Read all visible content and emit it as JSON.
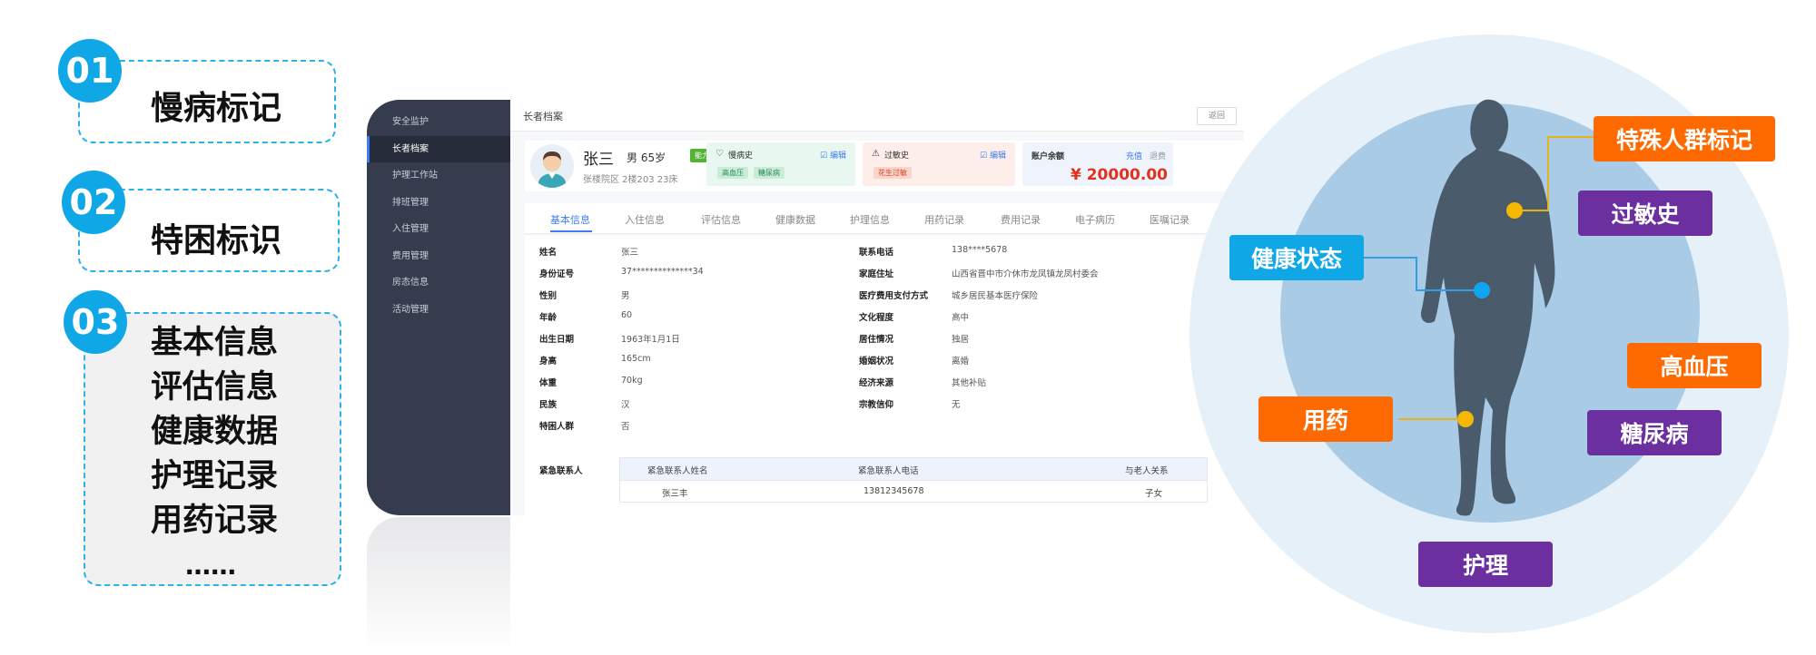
{
  "features": [
    {
      "num": "01",
      "label": "慢病标记"
    },
    {
      "num": "02",
      "label": "特困标识"
    },
    {
      "num": "03",
      "items": [
        "基本信息",
        "评估信息",
        "健康数据",
        "护理记录",
        "用药记录",
        "……"
      ]
    }
  ],
  "sidebar": {
    "items": [
      "安全监护",
      "长者档案",
      "护理工作站",
      "排班管理",
      "入住管理",
      "费用管理",
      "房态信息",
      "活动管理"
    ]
  },
  "header": {
    "breadcrumb": "长者档案",
    "back_label": "返回"
  },
  "profile": {
    "name": "张三",
    "meta": "男 65岁",
    "ability_badge": "能力完好",
    "address": "张楼院区 2楼203 23床"
  },
  "cards": {
    "chronic": {
      "title": "慢病史",
      "edit": "编辑",
      "tags": [
        "高血压",
        "糖尿病"
      ]
    },
    "allergy": {
      "title": "过敏史",
      "edit": "编辑",
      "tags": [
        "花生过敏"
      ]
    },
    "account": {
      "title": "账户余额",
      "recharge": "充值",
      "refund": "退费",
      "balance": "¥ 20000.00"
    }
  },
  "tabs": [
    "基本信息",
    "入住信息",
    "评估信息",
    "健康数据",
    "护理信息",
    "用药记录",
    "费用记录",
    "电子病历",
    "医嘱记录"
  ],
  "basic_info_left": [
    {
      "k": "姓名",
      "v": "张三"
    },
    {
      "k": "身份证号",
      "v": "37**************34"
    },
    {
      "k": "性别",
      "v": "男"
    },
    {
      "k": "年龄",
      "v": "60"
    },
    {
      "k": "出生日期",
      "v": "1963年1月1日"
    },
    {
      "k": "身高",
      "v": "165cm"
    },
    {
      "k": "体重",
      "v": "70kg"
    },
    {
      "k": "民族",
      "v": "汉"
    },
    {
      "k": "特困人群",
      "v": "否"
    }
  ],
  "basic_info_right": [
    {
      "k": "联系电话",
      "v": "138****5678"
    },
    {
      "k": "家庭住址",
      "v": "山西省晋中市介休市龙凤镇龙凤村委会"
    },
    {
      "k": "医疗费用支付方式",
      "v": "城乡居民基本医疗保险"
    },
    {
      "k": "文化程度",
      "v": "高中"
    },
    {
      "k": "居住情况",
      "v": "独居"
    },
    {
      "k": "婚姻状况",
      "v": "离婚"
    },
    {
      "k": "经济来源",
      "v": "其他补贴"
    },
    {
      "k": "宗教信仰",
      "v": "无"
    }
  ],
  "emergency": {
    "label": "紧急联系人",
    "headers": [
      "紧急联系人姓名",
      "紧急联系人电话",
      "与老人关系"
    ],
    "rows": [
      [
        "张三丰",
        "13812345678",
        "子女"
      ]
    ]
  },
  "tags_right": {
    "special": "特殊人群标记",
    "allergy": "过敏史",
    "health": "健康状态",
    "hypertension": "高血压",
    "medication": "用药",
    "diabetes": "糖尿病",
    "nursing": "护理"
  },
  "colors": {
    "cyan": "#0fa7e6",
    "orange": "#ff6a00",
    "purple": "#6b2fa0",
    "accent": "#3d7cf4"
  }
}
